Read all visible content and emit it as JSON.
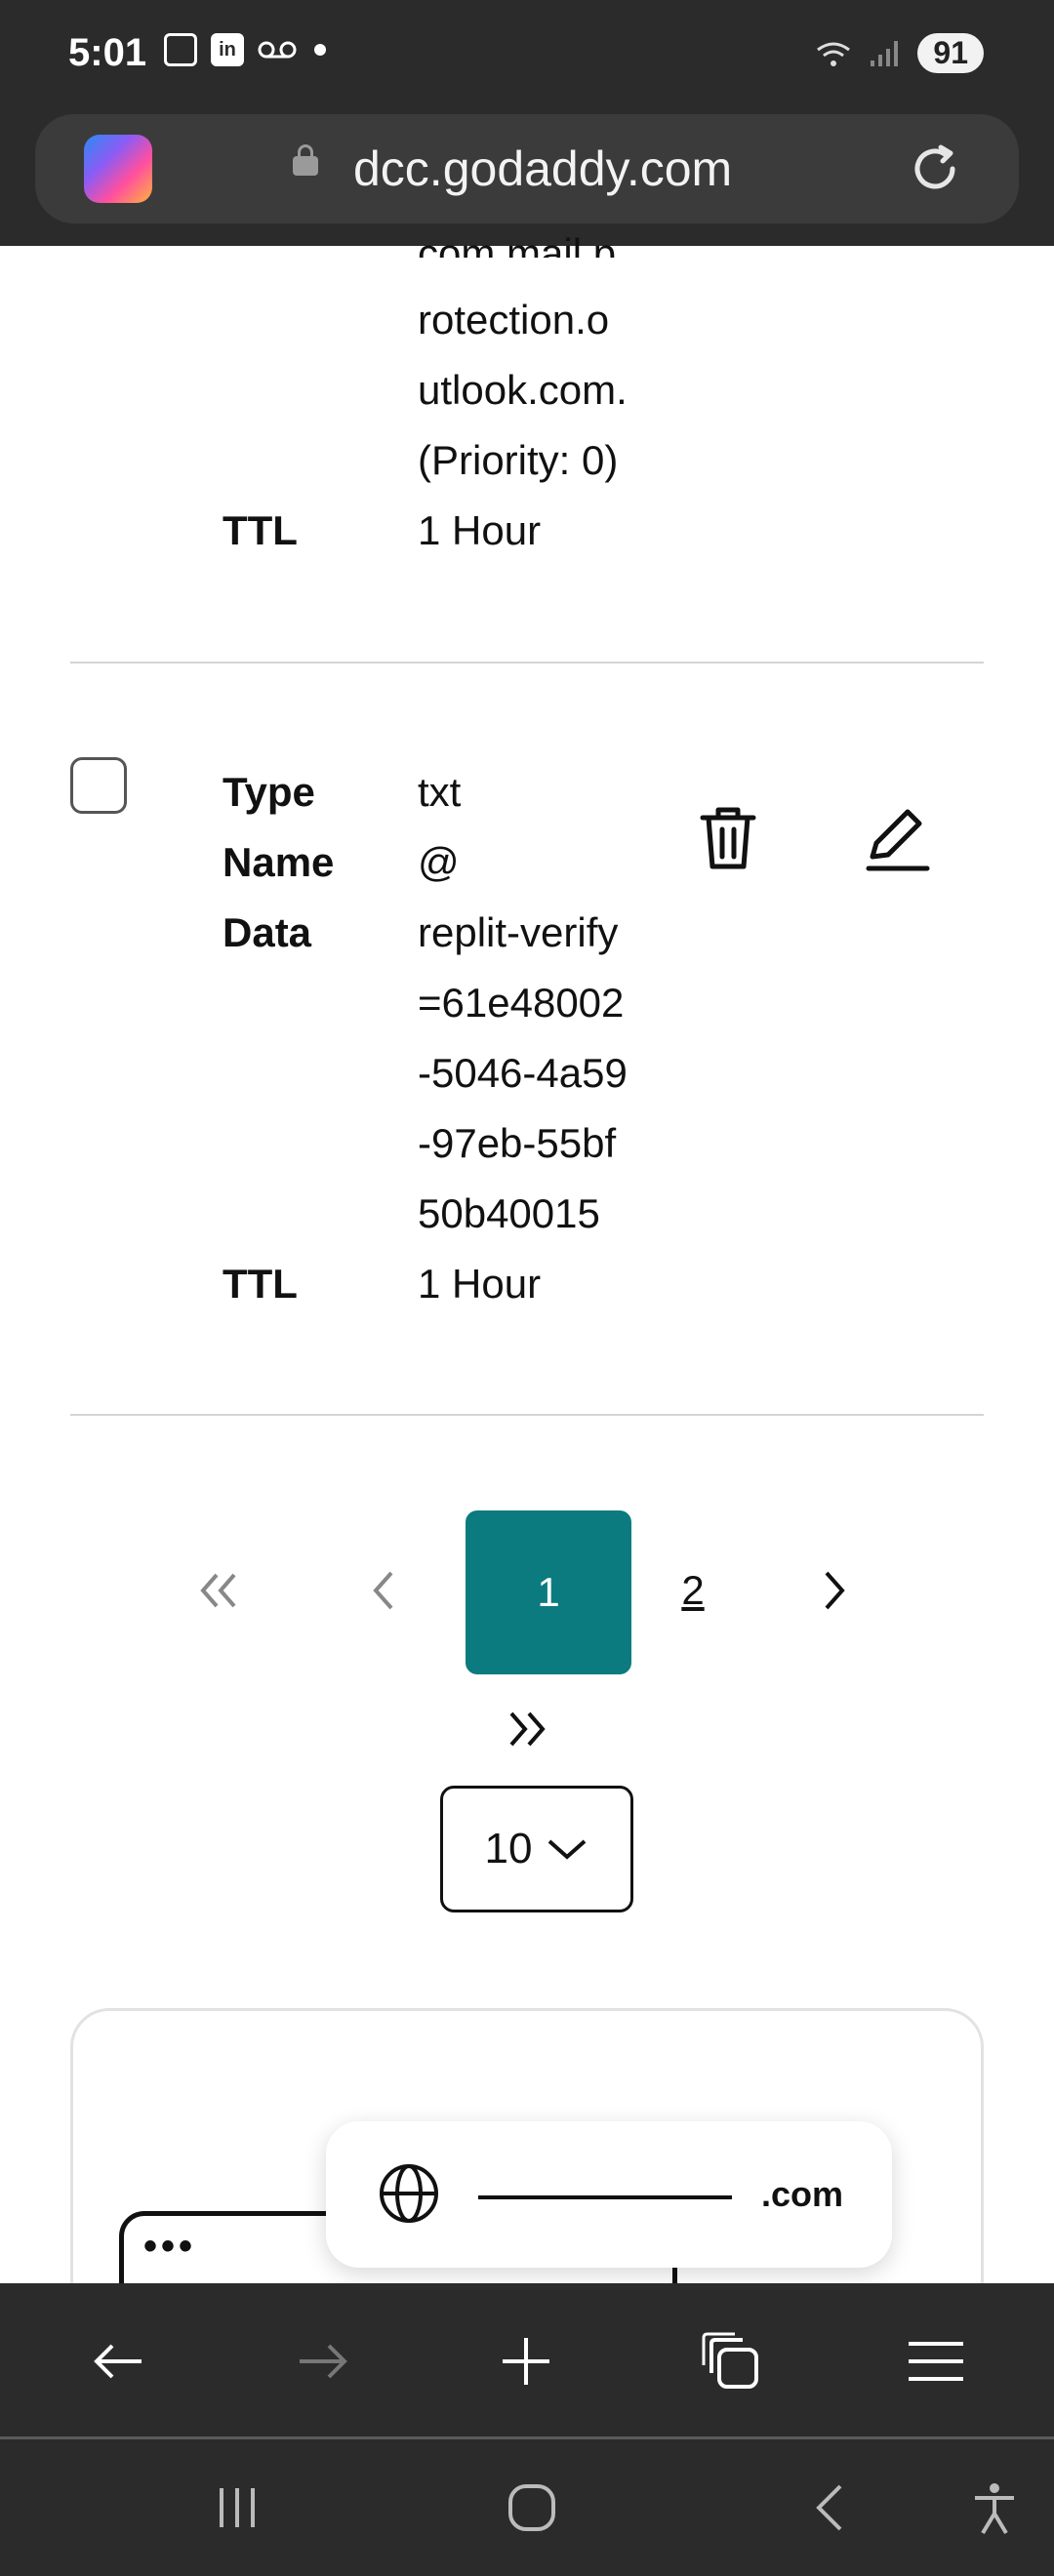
{
  "status_bar": {
    "time": "5:01",
    "battery": "91",
    "icons": [
      "calendar-icon",
      "linkedin-icon",
      "voicemail-icon",
      "dot-icon",
      "wifi-icon",
      "signal-icon"
    ]
  },
  "browser": {
    "url": "dcc.godaddy.com",
    "icons": [
      "copilot-icon",
      "lock-icon",
      "reload-icon"
    ]
  },
  "records": {
    "mx_partial": {
      "data_lines": [
        "com.mail.p",
        "rotection.o",
        "utlook.com.",
        "(Priority: 0)"
      ],
      "ttl_label": "TTL",
      "ttl_value": "1 Hour"
    },
    "txt": {
      "type_label": "Type",
      "type_value": "txt",
      "name_label": "Name",
      "name_value": "@",
      "data_label": "Data",
      "data_lines": [
        "replit-verify",
        "=61e48002",
        "-5046-4a59",
        "-97eb-55bf",
        "50b40015"
      ],
      "ttl_label": "TTL",
      "ttl_value": "1 Hour"
    }
  },
  "pagination": {
    "current": "1",
    "next_page": "2",
    "per_page": "10"
  },
  "promo": {
    "tld": ".com",
    "dots": "•••"
  }
}
